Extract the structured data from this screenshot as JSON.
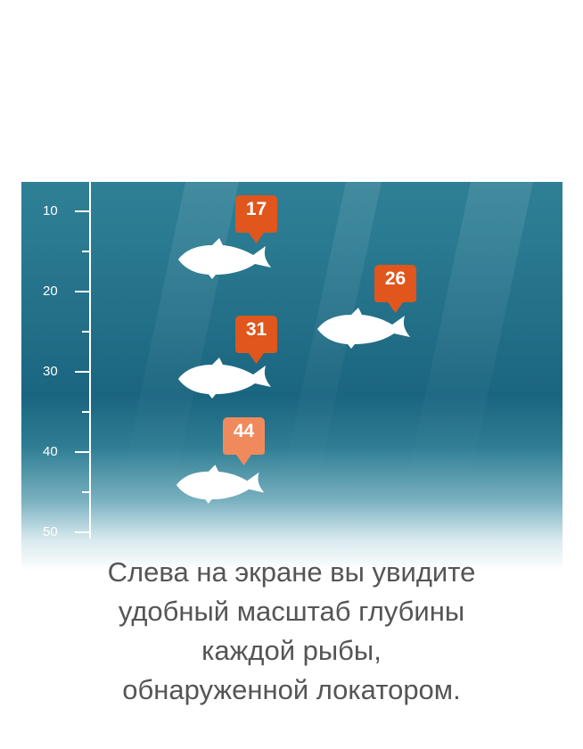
{
  "depth_scale": {
    "labels": [
      "10",
      "20",
      "30",
      "40",
      "50"
    ]
  },
  "fish": [
    {
      "depth": "17",
      "marker_color": "#e0561c"
    },
    {
      "depth": "26",
      "marker_color": "#e0561c"
    },
    {
      "depth": "31",
      "marker_color": "#e0561c"
    },
    {
      "depth": "44",
      "marker_color": "#f08a5d"
    }
  ],
  "caption": {
    "lines": [
      "Слева на экране вы увидите",
      "удобный масштаб глубины",
      "каждой рыбы,",
      "обнаруженной локатором."
    ]
  },
  "colors": {
    "water_top": "#2f7f95",
    "water_deep": "#1a6580",
    "marker": "#e0561c",
    "caption_text": "#555555"
  }
}
